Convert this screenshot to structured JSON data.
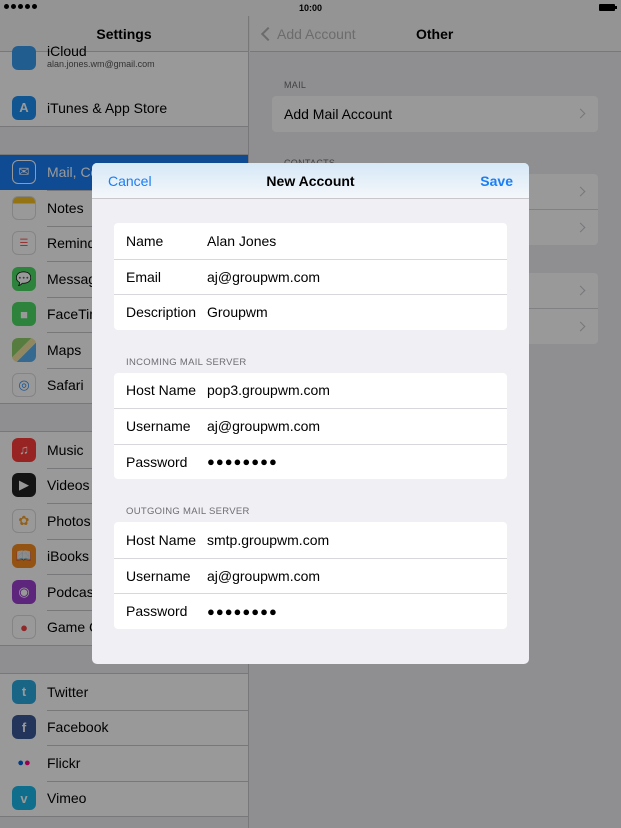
{
  "status": {
    "time": "10:00"
  },
  "sidebar": {
    "title": "Settings",
    "icloud": {
      "label": "iCloud",
      "sublabel": "alan.jones.wm@gmail.com"
    },
    "itunes": {
      "label": "iTunes & App Store"
    },
    "group2": [
      {
        "label": "Mail, Contacts, Calendars",
        "icon": "mail-icon",
        "color": "#1a7ef5",
        "selected": true
      },
      {
        "label": "Notes",
        "icon": "notes-icon",
        "color": "#f5c022"
      },
      {
        "label": "Reminders",
        "icon": "reminders-icon",
        "color": "#ffffff"
      },
      {
        "label": "Messages",
        "icon": "messages-icon",
        "color": "#4cd964"
      },
      {
        "label": "FaceTime",
        "icon": "facetime-icon",
        "color": "#4cd964"
      },
      {
        "label": "Maps",
        "icon": "maps-icon",
        "color": "#8fd06a"
      },
      {
        "label": "Safari",
        "icon": "safari-icon",
        "color": "#2d8cf0"
      }
    ],
    "group3": [
      {
        "label": "Music",
        "icon": "music-icon",
        "color": "#fc3d39"
      },
      {
        "label": "Videos",
        "icon": "videos-icon",
        "color": "#222222"
      },
      {
        "label": "Photos",
        "icon": "photos-icon",
        "color": "#f0a030"
      },
      {
        "label": "iBooks",
        "icon": "ibooks-icon",
        "color": "#f58a1f"
      },
      {
        "label": "Podcasts",
        "icon": "podcasts-icon",
        "color": "#9b3fcf"
      },
      {
        "label": "Game Center",
        "icon": "game-center-icon",
        "color": "#8a8a8a"
      }
    ],
    "group4": [
      {
        "label": "Twitter",
        "icon": "twitter-icon",
        "color": "#2aa9e0"
      },
      {
        "label": "Facebook",
        "icon": "facebook-icon",
        "color": "#3b5998"
      },
      {
        "label": "Flickr",
        "icon": "flickr-icon",
        "color": "#ffffff"
      },
      {
        "label": "Vimeo",
        "icon": "vimeo-icon",
        "color": "#1ab7ea"
      }
    ]
  },
  "detail": {
    "back_label": "Add Account",
    "title": "Other",
    "mail_header": "MAIL",
    "add_mail": "Add Mail Account",
    "contacts_header": "CONTACTS"
  },
  "modal": {
    "cancel": "Cancel",
    "title": "New Account",
    "save": "Save",
    "account": [
      {
        "label": "Name",
        "value": "Alan Jones"
      },
      {
        "label": "Email",
        "value": "aj@groupwm.com"
      },
      {
        "label": "Description",
        "value": "Groupwm"
      }
    ],
    "incoming_header": "INCOMING MAIL SERVER",
    "incoming": [
      {
        "label": "Host Name",
        "value": "pop3.groupwm.com"
      },
      {
        "label": "Username",
        "value": "aj@groupwm.com"
      },
      {
        "label": "Password",
        "value": "●●●●●●●●"
      }
    ],
    "outgoing_header": "OUTGOING MAIL SERVER",
    "outgoing": [
      {
        "label": "Host Name",
        "value": "smtp.groupwm.com"
      },
      {
        "label": "Username",
        "value": "aj@groupwm.com"
      },
      {
        "label": "Password",
        "value": "●●●●●●●●"
      }
    ]
  }
}
